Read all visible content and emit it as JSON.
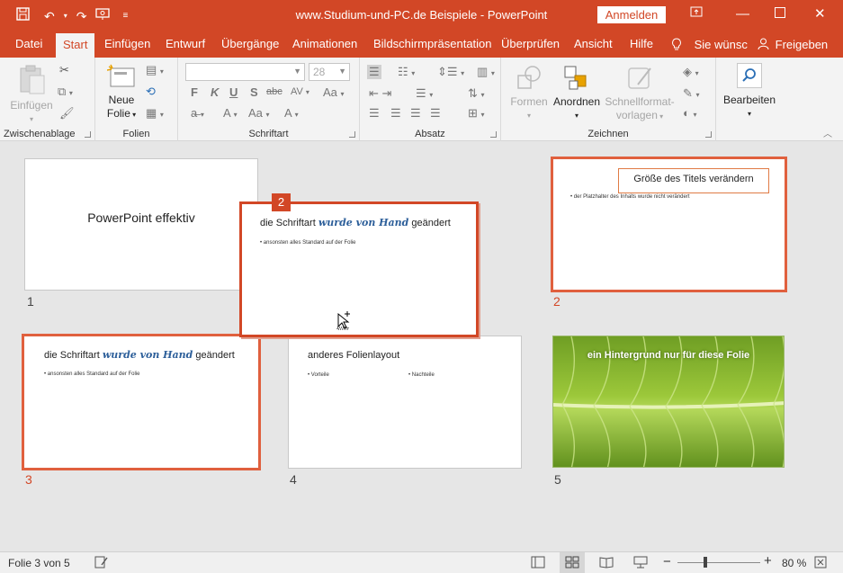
{
  "window": {
    "title": "www.Studium-und-PC.de  Beispiele  -  PowerPoint",
    "signin_label": "Anmelden",
    "accent": "#d24726"
  },
  "qat": {
    "save": "save-icon",
    "undo": "undo-icon",
    "redo": "redo-icon",
    "present": "present-icon",
    "customize": "customize-icon"
  },
  "tabs": [
    "Datei",
    "Start",
    "Einfügen",
    "Entwurf",
    "Übergänge",
    "Animationen",
    "Bildschirmpräsentation",
    "Überprüfen",
    "Ansicht",
    "Hilfe"
  ],
  "tell_me": "Sie wünsc",
  "share": "Freigeben",
  "ribbon": {
    "clipboard": {
      "label": "Zwischenablage",
      "paste": "Einfügen"
    },
    "slides": {
      "label": "Folien",
      "new_slide_line1": "Neue",
      "new_slide_line2": "Folie"
    },
    "font": {
      "label": "Schriftart",
      "font_name": "",
      "font_size": "28"
    },
    "paragraph": {
      "label": "Absatz"
    },
    "drawing": {
      "label": "Zeichnen",
      "shapes": "Formen",
      "arrange": "Anordnen",
      "quickstyles_line1": "Schnellformat-",
      "quickstyles_line2": "vorlagen"
    },
    "editing": {
      "label": "Bearbeiten"
    }
  },
  "slides": [
    {
      "number": "1",
      "title": "PowerPoint effektiv"
    },
    {
      "number": "2",
      "title": "Größe des Titels verändern",
      "bullet": "der Platzhalter des Inhalts wurde nicht verändert"
    },
    {
      "number": "3",
      "title_pre": "die Schriftart ",
      "title_hand": "wurde von Hand",
      "title_post": " geändert",
      "bullet": "ansonsten alles Standard auf der Folie"
    },
    {
      "number": "4",
      "title": "anderes Folienlayout",
      "bullet_left": "Vorteile",
      "bullet_right": "Nachteile"
    },
    {
      "number": "5",
      "title": "ein Hintergrund nur für diese Folie"
    }
  ],
  "drag_slide": {
    "badge": "2",
    "title_pre": "die Schriftart ",
    "title_hand": "wurde von Hand",
    "title_post": " geändert",
    "bullet": "ansonsten alles Standard auf der Folie"
  },
  "status": {
    "slide_info": "Folie 3 von 5",
    "zoom": "80 %",
    "zoom_level": 0.8
  }
}
